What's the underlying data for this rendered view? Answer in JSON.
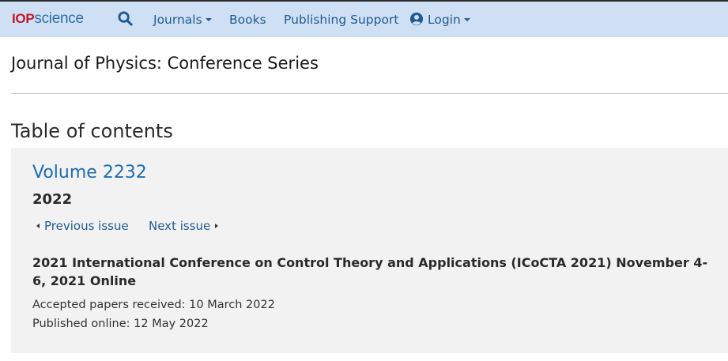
{
  "nav": {
    "logo_brand": "IOP",
    "logo_suffix": "science",
    "journals_label": "Journals",
    "books_label": "Books",
    "publishing_support_label": "Publishing Support",
    "login_label": "Login",
    "brand_colors": {
      "background": "#cfe0f5",
      "iop_red": "#c0172b",
      "link_blue": "#1f5b93"
    }
  },
  "page": {
    "journal_title": "Journal of Physics: Conference Series",
    "toc_heading": "Table of contents"
  },
  "issue": {
    "volume": "Volume 2232",
    "year": "2022",
    "previous_label": "Previous issue",
    "next_label": "Next issue",
    "conference_title": "2021 International Conference on Control Theory and Applications (ICoCTA 2021) November 4-6, 2021 Online",
    "accepted": "Accepted papers received: 10 March 2022",
    "published": "Published online: 12 May 2022"
  }
}
